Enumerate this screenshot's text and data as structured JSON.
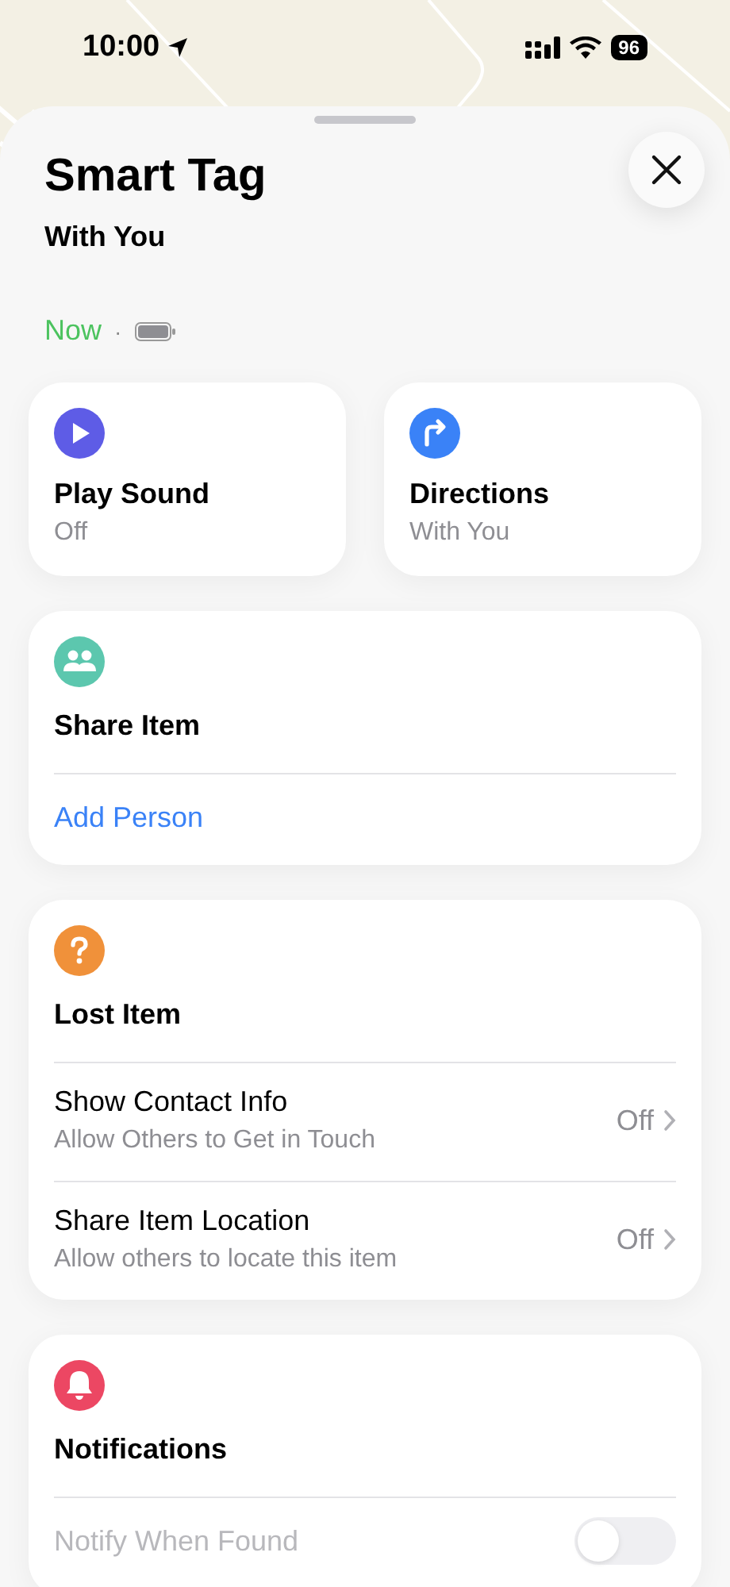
{
  "status_bar": {
    "time": "10:00",
    "battery": "96"
  },
  "title": "Smart Tag",
  "subtitle": "With You",
  "last_seen": "Now",
  "separator": "·",
  "actions": [
    {
      "kind": "sound",
      "label": "Play Sound",
      "value": "Off",
      "color": "#5e5ce6"
    },
    {
      "kind": "directions",
      "label": "Directions",
      "value": "With You",
      "color": "#3a82f7"
    }
  ],
  "sections": [
    {
      "kind": "share",
      "title": "Share Item",
      "color": "#5cc7ae",
      "rows": [
        {
          "kind": "link",
          "label": "Add Person"
        }
      ]
    },
    {
      "kind": "lost",
      "title": "Lost Item",
      "color": "#f0913a",
      "rows": [
        {
          "kind": "detail",
          "label": "Show Contact Info",
          "sublabel": "Allow Others to Get in Touch",
          "value": "Off"
        },
        {
          "kind": "detail",
          "label": "Share Item Location",
          "sublabel": "Allow others to locate this item",
          "value": "Off"
        }
      ]
    },
    {
      "kind": "notifications",
      "title": "Notifications",
      "color": "#ec4763",
      "rows": [
        {
          "kind": "toggle",
          "label": "Notify When Found",
          "on": false,
          "disabled": true
        }
      ]
    }
  ]
}
